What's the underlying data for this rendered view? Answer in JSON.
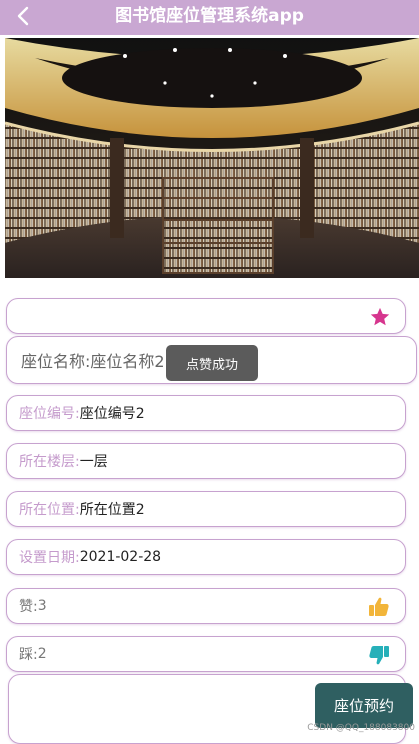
{
  "header": {
    "title": "图书馆座位管理系统app"
  },
  "toast": {
    "text": "点赞成功"
  },
  "seat": {
    "name_label": "座位名称:",
    "name_value": "座位名称2",
    "number_label": "座位编号:",
    "number_value": "座位编号2",
    "floor_label": "所在楼层:",
    "floor_value": "一层",
    "location_label": "所在位置:",
    "location_value": "所在位置2",
    "date_label": "设置日期:",
    "date_value": "2021-02-28",
    "like_label": "赞:",
    "like_count": "3",
    "dislike_label": "踩:",
    "dislike_count": "2"
  },
  "actions": {
    "reserve_label": "座位预约"
  },
  "watermark": "CSDN @QQ_188083800",
  "colors": {
    "header_bg": "#c9a7d2",
    "accent_purple": "#c59bcc",
    "star": "#d6358e",
    "like": "#f2b53a",
    "dislike": "#26b0b9",
    "button_bg": "#2f5f61"
  }
}
